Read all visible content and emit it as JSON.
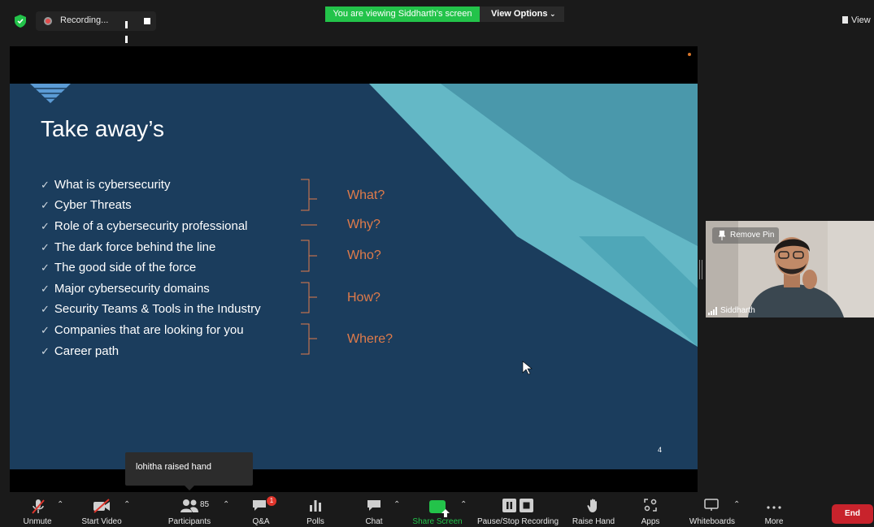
{
  "top_bar": {
    "recording_label": "Recording...",
    "viewing_banner": "You are viewing Siddharth's screen",
    "view_options_label": "View Options",
    "view_label": "View"
  },
  "slide": {
    "title": "Take away’s",
    "bullets": [
      "What is cybersecurity",
      "Cyber Threats",
      "Role of a cybersecurity professional",
      "The dark force behind the line",
      "The good side of the force",
      "Major cybersecurity domains",
      "Security Teams & Tools in the Industry",
      "Companies that are looking for you",
      "Career path"
    ],
    "answers": [
      "What?",
      "Why?",
      "Who?",
      "How?",
      "Where?"
    ],
    "page_number": "4"
  },
  "video_tile": {
    "remove_pin_label": "Remove Pin",
    "participant_name": "Siddharth"
  },
  "notification": {
    "text": "lohitha raised hand"
  },
  "toolbar": {
    "unmute": "Unmute",
    "start_video": "Start Video",
    "participants": "Participants",
    "participants_count": "85",
    "qa": "Q&A",
    "qa_badge": "1",
    "polls": "Polls",
    "chat": "Chat",
    "share_screen": "Share Screen",
    "pause_stop_recording": "Pause/Stop Recording",
    "raise_hand": "Raise Hand",
    "apps": "Apps",
    "whiteboards": "Whiteboards",
    "more": "More",
    "end": "End"
  },
  "colors": {
    "share_green": "#23c34a",
    "end_red": "#c8232c",
    "slide_bg": "#1b3d5d",
    "slide_accent": "#e07b4a"
  }
}
